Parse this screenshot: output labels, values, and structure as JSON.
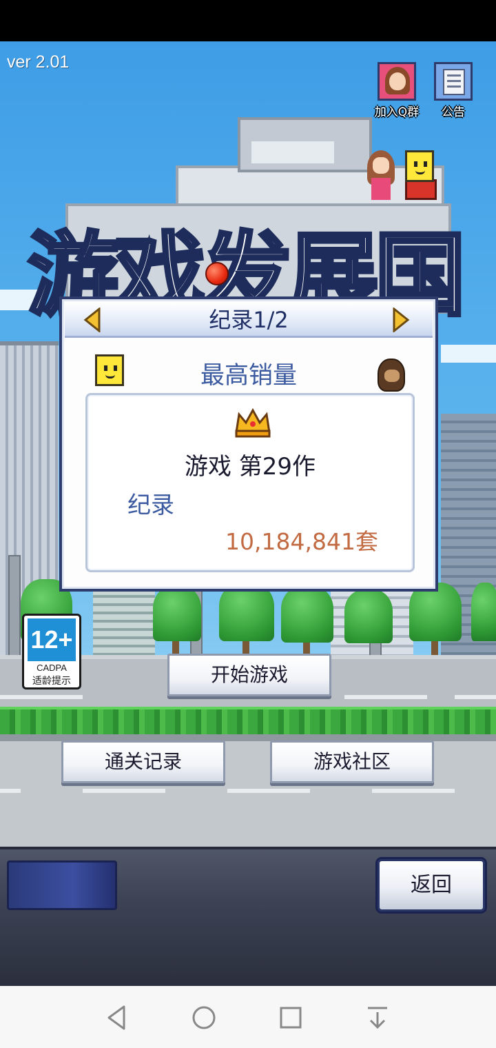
{
  "app": {
    "version": "ver 2.01",
    "logo_text": "游戏发展国"
  },
  "top_buttons": {
    "join_group": {
      "label": "加入Q群",
      "icon": "girl-portrait-icon"
    },
    "notice": {
      "label": "公告",
      "icon": "document-icon"
    }
  },
  "dialog": {
    "title": "纪录1/2",
    "prev_icon": "arrow-left-icon",
    "next_icon": "arrow-right-icon",
    "section_title": "最高销量",
    "record": {
      "icon": "crown-icon",
      "game_name": "游戏 第29作",
      "label": "纪录",
      "value": "10,184,841套"
    }
  },
  "age_rating": {
    "age": "12+",
    "org": "CADPA",
    "tip": "适龄提示"
  },
  "menu": {
    "start": "开始游戏",
    "records": "通关记录",
    "community": "游戏社区",
    "back": "返回"
  },
  "nav_bar": {
    "back_icon": "triangle-back-icon",
    "home_icon": "circle-home-icon",
    "recent_icon": "square-recents-icon",
    "down_icon": "collapse-down-icon"
  },
  "colors": {
    "dialog_border": "#2e3c6e",
    "title_text": "#1f2f66",
    "label_blue": "#3b5aa0",
    "value_orange": "#c26a42",
    "age_badge_blue": "#1f8fd6"
  }
}
